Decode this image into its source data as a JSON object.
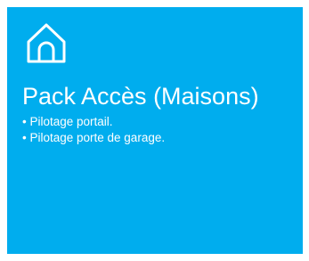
{
  "card": {
    "background_color": "#00adee",
    "text_color": "#ffffff",
    "icon": "home-icon",
    "title": "Pack Accès (Maisons)",
    "features": [
      "• Pilotage portail.",
      "• Pilotage porte de garage."
    ]
  }
}
